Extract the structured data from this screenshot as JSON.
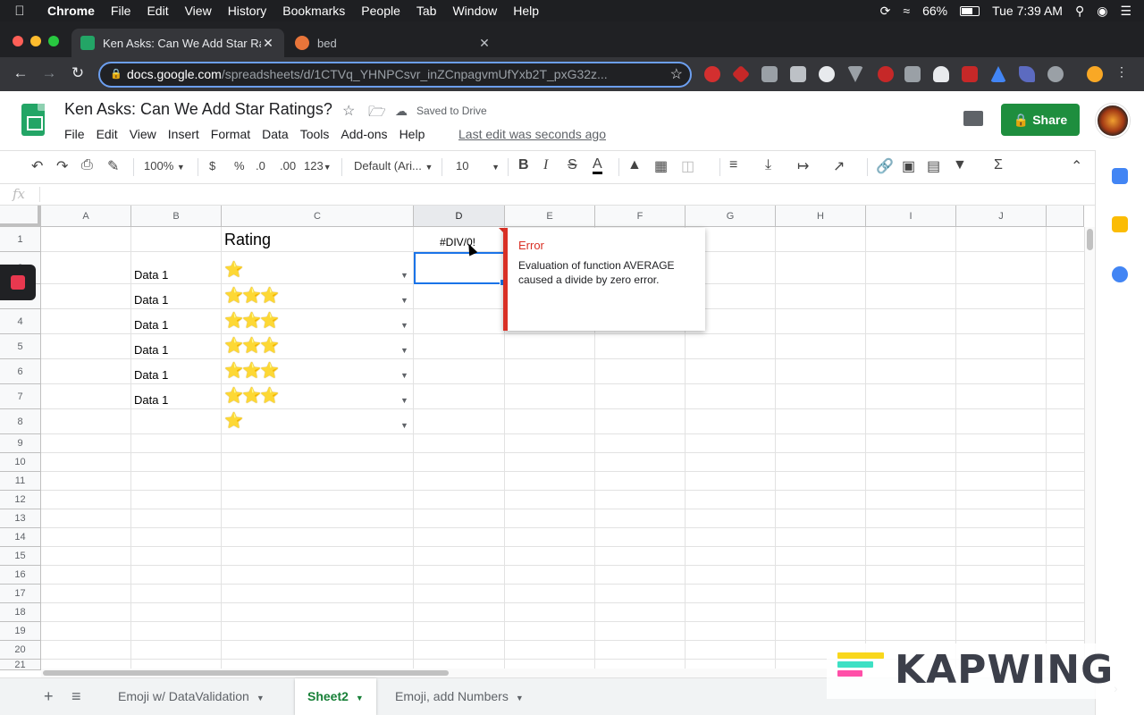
{
  "mac_menubar": {
    "app": "Chrome",
    "items": [
      "File",
      "Edit",
      "View",
      "History",
      "Bookmarks",
      "People",
      "Tab",
      "Window",
      "Help"
    ],
    "battery": "66%",
    "clock": "Tue 7:39 AM"
  },
  "browser": {
    "tabs": [
      {
        "title": "Ken Asks: Can We Add Star Ra",
        "favicon_color": "#23a566"
      },
      {
        "title": "bed",
        "favicon_color": "#e8753a"
      }
    ],
    "url_host": "docs.google.com",
    "url_path": "/spreadsheets/d/1CTVq_YHNPCsvr_inZCnpagvmUfYxb2T_pxG32z..."
  },
  "doc": {
    "title": "Ken Asks: Can We Add Star Ratings?",
    "saved_status": "Saved to Drive",
    "menu": [
      "File",
      "Edit",
      "View",
      "Insert",
      "Format",
      "Data",
      "Tools",
      "Add-ons",
      "Help"
    ],
    "last_edit": "Last edit was seconds ago",
    "share_label": "Share"
  },
  "toolbar": {
    "zoom": "100%",
    "currency": "$",
    "percent": "%",
    "dec_decrease": ".0",
    "dec_increase": ".00",
    "number_format": "123",
    "font": "Default (Ari...",
    "font_size": "10"
  },
  "grid": {
    "columns": [
      "A",
      "B",
      "C",
      "D",
      "E",
      "F",
      "G",
      "H",
      "I",
      "J"
    ],
    "selected_column": "D",
    "rows": [
      "1",
      "2",
      "3",
      "4",
      "5",
      "6",
      "7",
      "8",
      "9",
      "10",
      "11",
      "12",
      "13",
      "14",
      "15",
      "16",
      "17",
      "18",
      "19",
      "20",
      "21"
    ],
    "c1_header": "Rating",
    "d1_value": "#DIV/0!",
    "data_rows": [
      {
        "label": "Data 1",
        "stars": "⭐"
      },
      {
        "label": "Data 1",
        "stars": "⭐⭐⭐"
      },
      {
        "label": "Data 1",
        "stars": "⭐⭐⭐"
      },
      {
        "label": "Data 1",
        "stars": "⭐⭐⭐"
      },
      {
        "label": "Data 1",
        "stars": "⭐⭐⭐"
      },
      {
        "label": "Data 1",
        "stars": "⭐⭐⭐"
      },
      {
        "label": "",
        "stars": "⭐"
      }
    ]
  },
  "error_popup": {
    "title": "Error",
    "message": "Evaluation of function AVERAGE caused a divide by zero error."
  },
  "sheet_tabs": [
    {
      "label": "Emoji w/ DataValidation",
      "active": false
    },
    {
      "label": "Sheet2",
      "active": true
    },
    {
      "label": "Emoji, add Numbers",
      "active": false
    }
  ],
  "watermark": "KAPWING",
  "colors": {
    "sheets_green": "#23a566",
    "share_green": "#1e8e3e",
    "error_red": "#d93025",
    "selection_blue": "#1a73e8"
  }
}
